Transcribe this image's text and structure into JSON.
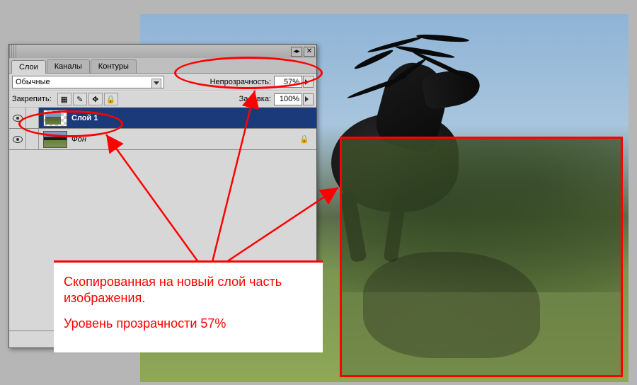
{
  "panel": {
    "tabs": [
      {
        "label": "Слои",
        "active": true
      },
      {
        "label": "Каналы",
        "active": false
      },
      {
        "label": "Контуры",
        "active": false
      }
    ],
    "blend_mode": "Обычные",
    "opacity_label": "Непрозрачность:",
    "opacity_value": "57%",
    "lock_label": "Закрепить:",
    "fill_label": "Заливка:",
    "fill_value": "100%",
    "layers": [
      {
        "name": "Слой 1",
        "selected": true,
        "visible": true,
        "locked": false,
        "thumb": "checker"
      },
      {
        "name": "Фон",
        "selected": false,
        "visible": true,
        "locked": true,
        "thumb": "full"
      }
    ],
    "footer_icons": [
      "link",
      "fx",
      "mask",
      "adjust",
      "folder",
      "new",
      "trash"
    ]
  },
  "annotation": {
    "line1": "Скопированная на новый слой часть изображения.",
    "line2": "Уровень прозрачности 57%"
  }
}
